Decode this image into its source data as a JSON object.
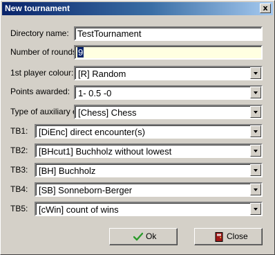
{
  "window": {
    "title": "New tournament",
    "close_label": "x"
  },
  "form": {
    "directory": {
      "label": "Directory name:",
      "value": "TestTournament"
    },
    "rounds": {
      "label": "Number of rounds:",
      "value": "9"
    },
    "colour": {
      "label": "1st player colour:",
      "value": "[R] Random"
    },
    "points": {
      "label": "Points awarded:",
      "value": "1- 0.5 -0"
    },
    "auxiliary": {
      "label": "Type of auxiliary ev",
      "value": "[Chess] Chess"
    },
    "tiebreaks": [
      {
        "label": "TB1:",
        "value": "[DiEnc] direct encounter(s)"
      },
      {
        "label": "TB2:",
        "value": "[BHcut1] Buchholz without lowest"
      },
      {
        "label": "TB3:",
        "value": "[BH] Buchholz"
      },
      {
        "label": "TB4:",
        "value": "[SB] Sonneborn-Berger"
      },
      {
        "label": "TB5:",
        "value": "[cWin] count of wins"
      }
    ]
  },
  "buttons": {
    "ok_label": "Ok",
    "close_label": "Close"
  },
  "colors": {
    "titlebar_start": "#0a246a",
    "titlebar_end": "#a6caf0",
    "face": "#d4d0c8",
    "rounds_bg": "#ffffe1",
    "ok_icon": "#2a9a2a",
    "close_icon": "#a01818"
  },
  "icons": {
    "ok": "check-icon",
    "close": "exit-door-icon"
  }
}
